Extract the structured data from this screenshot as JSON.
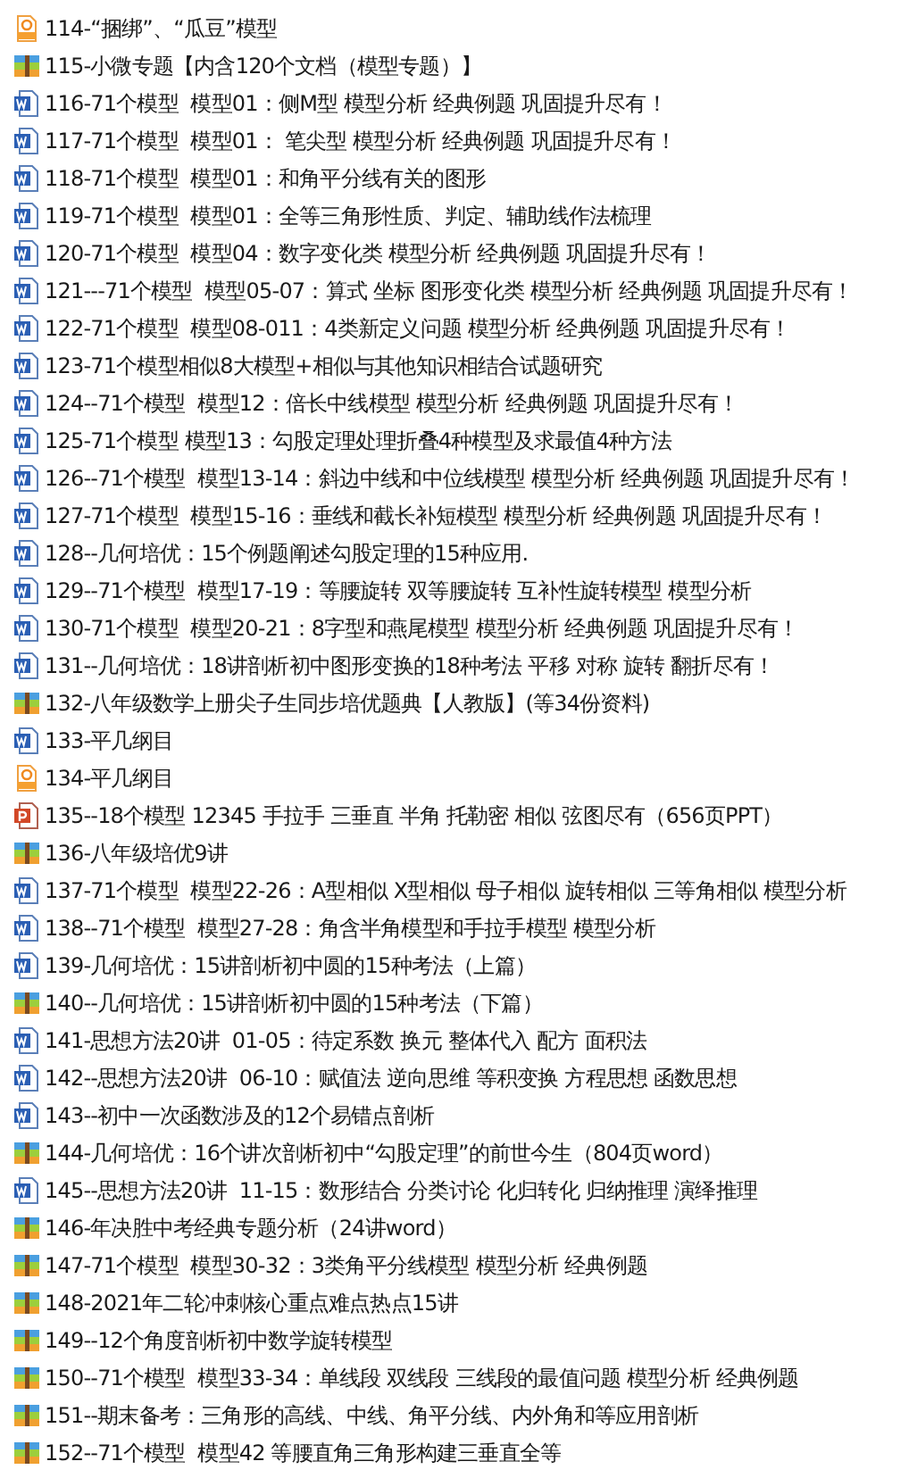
{
  "files": [
    {
      "kind": "pdf",
      "name": "114-“捆绑”、“瓜豆”模型"
    },
    {
      "kind": "zip",
      "name": "115-小微专题【内含120个文档（模型专题）】"
    },
    {
      "kind": "word",
      "name": "116-71个模型  模型01：侧M型 模型分析 经典例题 巩固提升尽有！"
    },
    {
      "kind": "word",
      "name": "117-71个模型  模型01： 笔尖型 模型分析 经典例题 巩固提升尽有！"
    },
    {
      "kind": "word",
      "name": "118-71个模型  模型01：和角平分线有关的图形"
    },
    {
      "kind": "word",
      "name": "119-71个模型  模型01：全等三角形性质、判定、辅助线作法梳理"
    },
    {
      "kind": "word",
      "name": "120-71个模型  模型04：数字变化类 模型分析 经典例题 巩固提升尽有！"
    },
    {
      "kind": "word",
      "name": "121---71个模型  模型05-07：算式 坐标 图形变化类 模型分析 经典例题 巩固提升尽有！"
    },
    {
      "kind": "word",
      "name": "122-71个模型  模型08-011：4类新定义问题 模型分析 经典例题 巩固提升尽有！"
    },
    {
      "kind": "word",
      "name": "123-71个模型相似8大模型+相似与其他知识相结合试题研究"
    },
    {
      "kind": "word",
      "name": "124--71个模型  模型12：倍长中线模型 模型分析 经典例题 巩固提升尽有！"
    },
    {
      "kind": "word",
      "name": "125-71个模型 模型13：勾股定理处理折叠4种模型及求最值4种方法"
    },
    {
      "kind": "word",
      "name": "126--71个模型  模型13-14：斜边中线和中位线模型 模型分析 经典例题 巩固提升尽有！"
    },
    {
      "kind": "word",
      "name": "127-71个模型  模型15-16：垂线和截长补短模型 模型分析 经典例题 巩固提升尽有！"
    },
    {
      "kind": "word",
      "name": "128--几何培优：15个例题阐述勾股定理的15种应用."
    },
    {
      "kind": "word",
      "name": "129--71个模型  模型17-19：等腰旋转 双等腰旋转 互补性旋转模型 模型分析"
    },
    {
      "kind": "word",
      "name": "130-71个模型  模型20-21：8字型和燕尾模型 模型分析 经典例题 巩固提升尽有！"
    },
    {
      "kind": "word",
      "name": "131--几何培优：18讲剖析初中图形变换的18种考法 平移 对称 旋转 翻折尽有！"
    },
    {
      "kind": "zip",
      "name": "132-八年级数学上册尖子生同步培优题典【人教版】(等34份资料)"
    },
    {
      "kind": "word",
      "name": "133-平几纲目"
    },
    {
      "kind": "pdf",
      "name": "134-平几纲目"
    },
    {
      "kind": "ppt",
      "name": "135--18个模型 12345 手拉手 三垂直 半角 托勒密 相似 弦图尽有（656页PPT）"
    },
    {
      "kind": "zip",
      "name": "136-八年级培优9讲"
    },
    {
      "kind": "word",
      "name": "137-71个模型  模型22-26：A型相似 X型相似 母子相似 旋转相似 三等角相似 模型分析"
    },
    {
      "kind": "word",
      "name": "138--71个模型  模型27-28：角含半角模型和手拉手模型 模型分析"
    },
    {
      "kind": "word",
      "name": "139-几何培优：15讲剖析初中圆的15种考法（上篇）"
    },
    {
      "kind": "zip",
      "name": "140--几何培优：15讲剖析初中圆的15种考法（下篇）"
    },
    {
      "kind": "word",
      "name": "141-思想方法20讲  01-05：待定系数 换元 整体代入 配方 面积法"
    },
    {
      "kind": "word",
      "name": "142--思想方法20讲  06-10：赋值法 逆向思维 等积变换 方程思想 函数思想"
    },
    {
      "kind": "word",
      "name": "143--初中一次函数涉及的12个易错点剖析"
    },
    {
      "kind": "zip",
      "name": "144-几何培优：16个讲次剖析初中“勾股定理”的前世今生（804页word）"
    },
    {
      "kind": "word",
      "name": "145--思想方法20讲  11-15：数形结合 分类讨论 化归转化 归纳推理 演绎推理"
    },
    {
      "kind": "zip",
      "name": "146-年决胜中考经典专题分析（24讲word）"
    },
    {
      "kind": "zip",
      "name": "147-71个模型  模型30-32：3类角平分线模型 模型分析 经典例题"
    },
    {
      "kind": "zip",
      "name": "148-2021年二轮冲刺核心重点难点热点15讲"
    },
    {
      "kind": "zip",
      "name": "149--12个角度剖析初中数学旋转模型"
    },
    {
      "kind": "zip",
      "name": "150--71个模型  模型33-34：单线段 双线段 三线段的最值问题 模型分析 经典例题"
    },
    {
      "kind": "zip",
      "name": "151--期末备考：三角形的高线、中线、角平分线、内外角和等应用剖析"
    },
    {
      "kind": "zip",
      "name": "152--71个模型  模型42 等腰直角三角形构建三垂直全等"
    }
  ]
}
